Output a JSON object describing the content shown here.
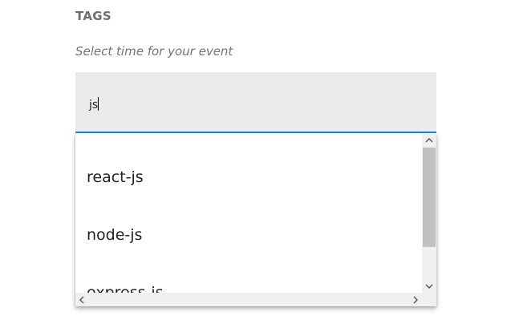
{
  "form": {
    "section_label": "TAGS",
    "hint": "Select time for your event",
    "input_value": "js"
  },
  "dropdown": {
    "options": [
      {
        "label": "react-js"
      },
      {
        "label": "node-js"
      },
      {
        "label": "express-js"
      }
    ]
  },
  "colors": {
    "accent": "#1e88e5",
    "input_background": "#ebebeb",
    "scrollbar_thumb": "#c1c1c1"
  }
}
